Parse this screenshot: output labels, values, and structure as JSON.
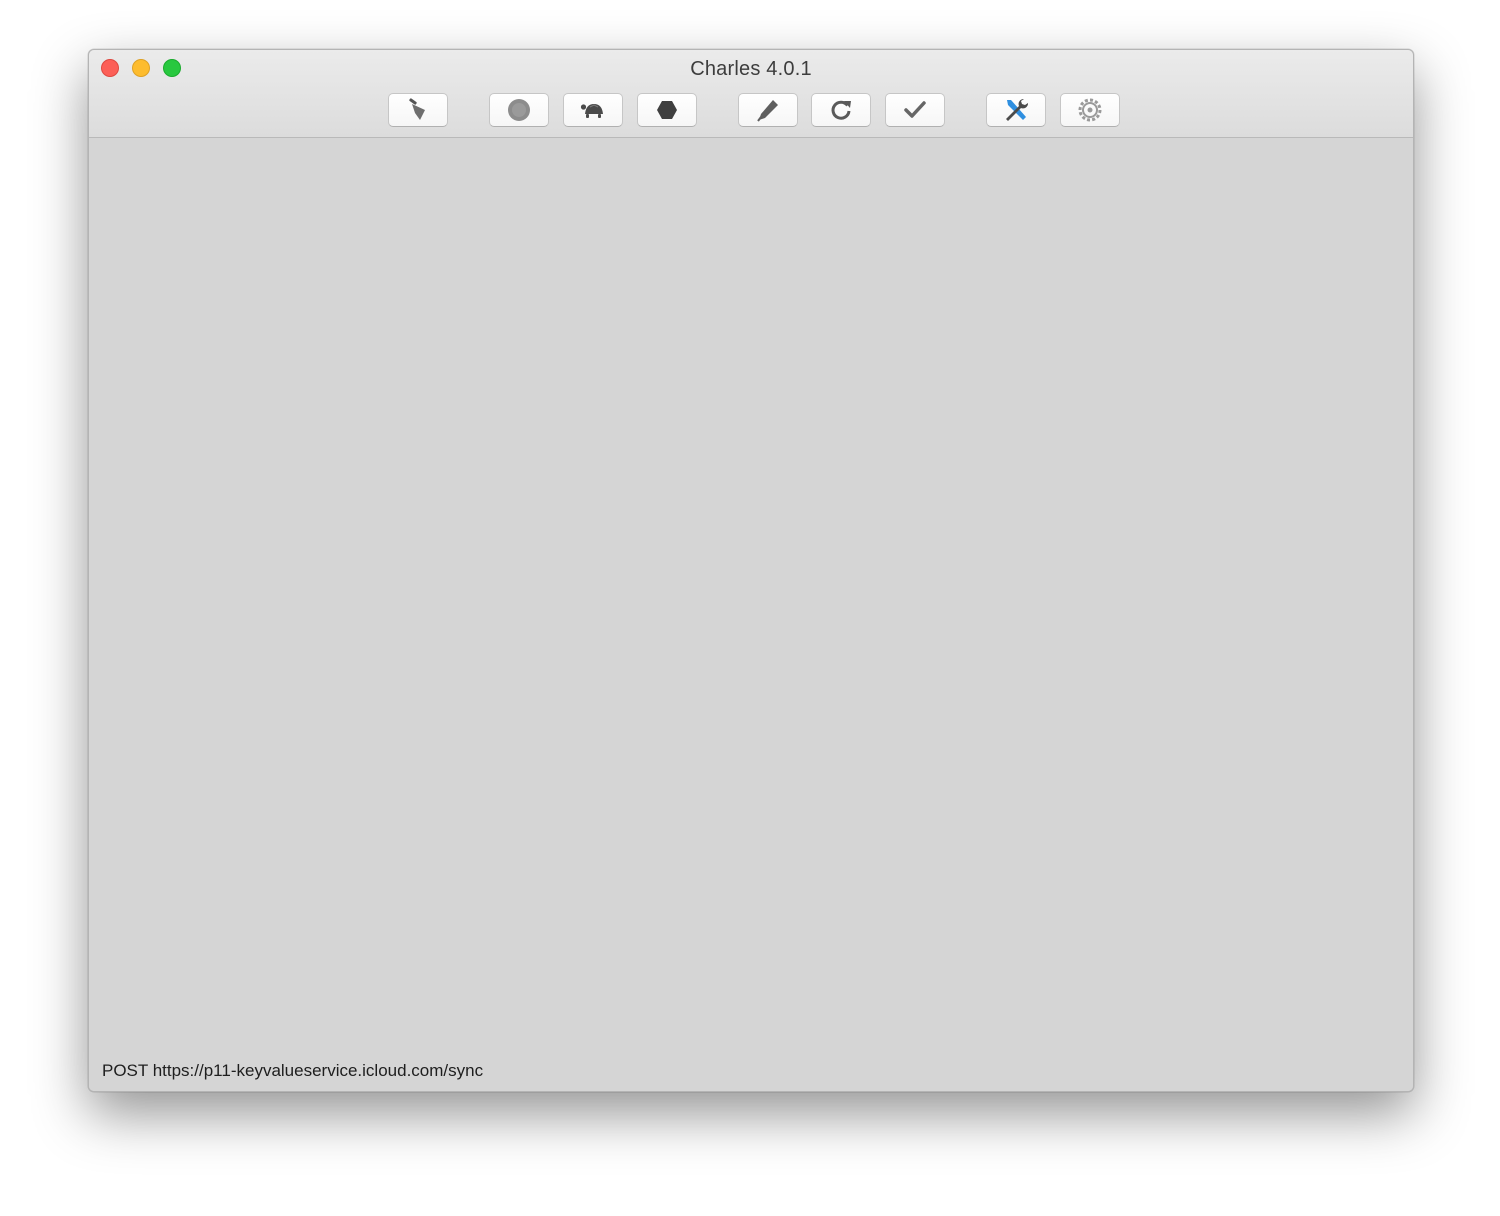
{
  "window": {
    "title": "Charles 4.0.1"
  },
  "toolbar": {
    "buttons": [
      {
        "icon": "broom-icon"
      },
      {
        "icon": "record-icon"
      },
      {
        "icon": "turtle-icon"
      },
      {
        "icon": "hexagon-stop-icon"
      },
      {
        "icon": "pen-icon"
      },
      {
        "icon": "refresh-icon"
      },
      {
        "icon": "checkmark-icon"
      },
      {
        "icon": "tools-icon"
      },
      {
        "icon": "gear-icon"
      }
    ]
  },
  "status_bar": {
    "text": "POST https://p11-keyvalueservice.icloud.com/sync"
  },
  "colors": {
    "close": "#fc5f57",
    "minimize": "#fdbc2e",
    "zoom": "#28c83f",
    "tools_accent": "#2f8fe0"
  }
}
